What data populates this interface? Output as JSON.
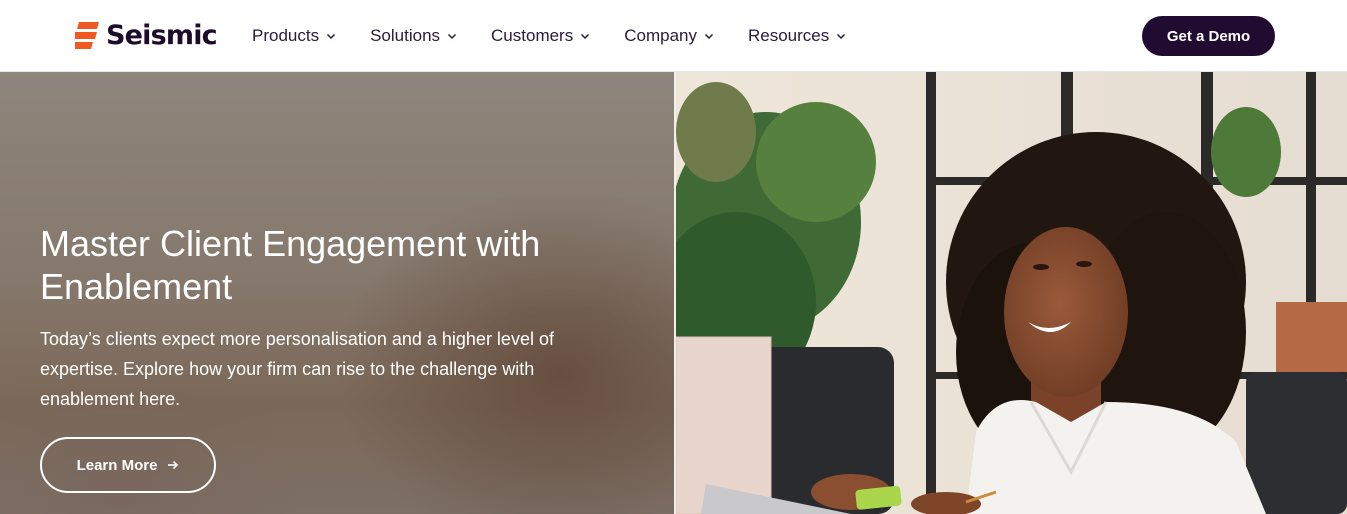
{
  "brand": {
    "name": "Seismic",
    "logo_icon": "seismic-logo-mark",
    "accent_color": "#f05a22",
    "dark_color": "#220b30"
  },
  "nav": {
    "items": [
      {
        "label": "Products",
        "icon": "chevron-down-icon"
      },
      {
        "label": "Solutions",
        "icon": "chevron-down-icon"
      },
      {
        "label": "Customers",
        "icon": "chevron-down-icon"
      },
      {
        "label": "Company",
        "icon": "chevron-down-icon"
      },
      {
        "label": "Resources",
        "icon": "chevron-down-icon"
      }
    ]
  },
  "header": {
    "cta_label": "Get a Demo"
  },
  "hero": {
    "title": "Master Client Engagement with Enablement",
    "description": "Today’s clients expect more personalisation and a higher level of expertise. Explore how your firm can rise to the challenge with enablement here.",
    "button_label": "Learn More",
    "button_icon": "arrow-right-icon",
    "image": "smiling-woman-photo"
  }
}
